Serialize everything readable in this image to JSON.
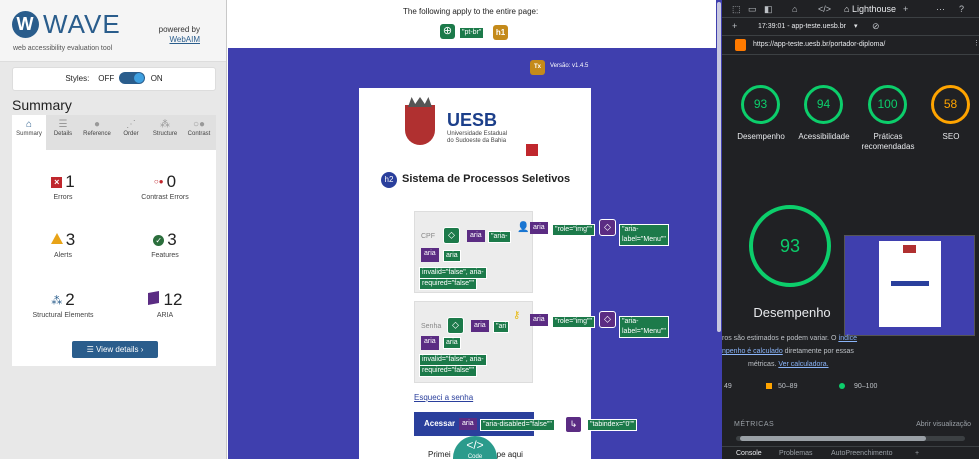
{
  "wave": {
    "logo": "WAVE",
    "subtitle": "web accessibility evaluation tool",
    "powered_by": "powered by",
    "webaim": "WebAIM",
    "styles_label": "Styles:",
    "styles_off": "OFF",
    "styles_on": "ON",
    "summary_title": "Summary",
    "tabs": [
      "Summary",
      "Details",
      "Reference",
      "Order",
      "Structure",
      "Contrast"
    ],
    "errors": {
      "count": "1",
      "label": "Errors"
    },
    "contrast_errors": {
      "count": "0",
      "label": "Contrast Errors"
    },
    "alerts": {
      "count": "3",
      "label": "Alerts"
    },
    "features": {
      "count": "3",
      "label": "Features"
    },
    "structural": {
      "count": "2",
      "label": "Structural Elements"
    },
    "aria": {
      "count": "12",
      "label": "ARIA"
    },
    "view_details": "View details ›"
  },
  "center": {
    "apply_text": "The following apply to the entire page:",
    "lang_badge": "\"pt-br\"",
    "h1_badge": "h1",
    "versao": "Versão: v1.4.5",
    "uesb_name": "UESB",
    "uesb_sub1": "Universidade Estadual",
    "uesb_sub2": "do Sudoeste da Bahia",
    "h2_badge": "h2",
    "page_title": "Sistema de Processos Seletivos",
    "cpf_label": "CPF",
    "senha_label": "Senha",
    "aria": "aria",
    "aria_short1": "\"aria-",
    "aria_short2": "\"ari",
    "role_img": "\"role=\"img\"\"",
    "aria_label_menu": "\"aria-label=\"Menu\"\"",
    "invalid_cpf_1": "invalid=\"false\", aria-",
    "invalid_cpf_2": "required=\"false\"\"",
    "invalid_senha_1": "invalid=\"false\", aria-",
    "invalid_senha_2": "required=\"false\"\"",
    "esqueci": "Esqueci a senha",
    "acessar": "Acessar",
    "aria_disabled": "\"aria-disabled=\"false\"\"",
    "tabindex": "\"tabindex=\"0\"\"",
    "primeiro_left": "Primei",
    "primeiro_right": "pe aqui",
    "code_label": "</>",
    "code_sub": "Code"
  },
  "lighthouse": {
    "tab_name": "Lighthouse",
    "timestamp": "17:39:01 - app-teste.uesb.br",
    "url": "https://app-teste.uesb.br/portador-diploma/",
    "scores": [
      {
        "value": "93",
        "label": "Desempenho"
      },
      {
        "value": "94",
        "label": "Acessibilidade"
      },
      {
        "value": "100",
        "label": "Práticas recomendadas"
      },
      {
        "value": "58",
        "label": "SEO"
      }
    ],
    "big_score": "93",
    "big_label": "Desempenho",
    "note_1a": "ros são estimados e podem variar. O ",
    "note_1b": "índice",
    "note_2a": "npenho é calculado",
    "note_2b": " diretamente por essas",
    "note_3a": "métricas. ",
    "note_3b": "Ver calculadora.",
    "legend_1": "49",
    "legend_2": "50–89",
    "legend_3": "90–100",
    "metricas": "MÉTRICAS",
    "abrir": "Abrir visualização",
    "bottom_console": "Console",
    "bottom_problemas": "Problemas",
    "bottom_autopreenchimento": "AutoPreenchimento",
    "colors": {
      "green": "#0cce6b",
      "orange": "#ffa400",
      "red": "#ff4e42"
    }
  }
}
